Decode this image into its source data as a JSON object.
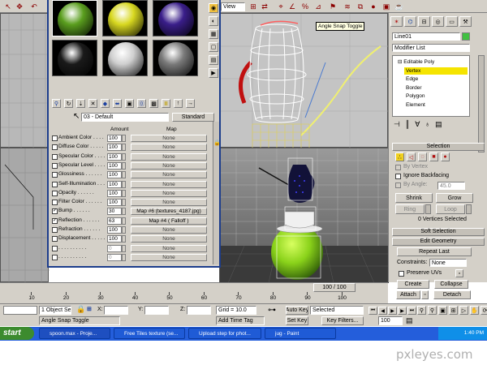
{
  "toolbar": {
    "view_label": "View",
    "snap_tooltip": "Angle Snap Toggle"
  },
  "material_editor": {
    "material_name": "03 - Default",
    "type_button": "Standard",
    "columns": {
      "amount": "Amount",
      "map": "Map"
    },
    "maps": [
      {
        "name": "Ambient Color",
        "checked": false,
        "amount": "100",
        "map": "None"
      },
      {
        "name": "Diffuse Color",
        "checked": false,
        "amount": "100",
        "map": "None"
      },
      {
        "name": "Specular Color",
        "checked": false,
        "amount": "100",
        "map": "None"
      },
      {
        "name": "Specular Level",
        "checked": false,
        "amount": "100",
        "map": "None"
      },
      {
        "name": "Glossiness",
        "checked": false,
        "amount": "100",
        "map": "None"
      },
      {
        "name": "Self-Illumination",
        "checked": false,
        "amount": "100",
        "map": "None"
      },
      {
        "name": "Opacity",
        "checked": false,
        "amount": "100",
        "map": "None"
      },
      {
        "name": "Filter Color",
        "checked": false,
        "amount": "100",
        "map": "None"
      },
      {
        "name": "Bump",
        "checked": true,
        "amount": "30",
        "map": "Map #6 (textures_4187.jpg)"
      },
      {
        "name": "Reflection",
        "checked": true,
        "amount": "63",
        "map": "Map #4  ( Falloff )"
      },
      {
        "name": "Refraction",
        "checked": false,
        "amount": "100",
        "map": "None"
      },
      {
        "name": "Displacement",
        "checked": false,
        "amount": "100",
        "map": "None"
      },
      {
        "name": "",
        "checked": false,
        "amount": "0",
        "map": "None"
      },
      {
        "name": "",
        "checked": false,
        "amount": "0",
        "map": "None"
      }
    ],
    "sample_spheres": [
      "#5a9e1e",
      "#d8d820",
      "#3a1e8a",
      "#1a1a1a",
      "#cfcfcf",
      "#7a7a7a"
    ]
  },
  "command_panel": {
    "object_name": "Line01",
    "modifier_list": "Modifier List",
    "stack": [
      {
        "label": "Editable Poly",
        "selected": false,
        "indent": false
      },
      {
        "label": "Vertex",
        "selected": true,
        "indent": true
      },
      {
        "label": "Edge",
        "selected": false,
        "indent": true
      },
      {
        "label": "Border",
        "selected": false,
        "indent": true
      },
      {
        "label": "Polygon",
        "selected": false,
        "indent": true
      },
      {
        "label": "Element",
        "selected": false,
        "indent": true
      }
    ],
    "selection": {
      "title": "Selection",
      "by_vertex": "By Vertex",
      "ignore_backfacing": "Ignore Backfacing",
      "by_angle": "By Angle:",
      "angle_value": "45.0",
      "shrink": "Shrink",
      "grow": "Grow",
      "ring": "Ring",
      "loop": "Loop",
      "status": "0 Vertices Selected"
    },
    "soft_selection": "Soft Selection",
    "edit_geometry": {
      "title": "Edit Geometry",
      "repeat_last": "Repeat Last",
      "constraints_label": "Constraints:",
      "constraints_value": "None",
      "preserve_uvs": "Preserve UVs",
      "create": "Create",
      "collapse": "Collapse",
      "attach": "Attach",
      "detach": "Detach"
    }
  },
  "timeline": {
    "frame": "100 / 100",
    "ticks": [
      "10",
      "20",
      "30",
      "40",
      "50",
      "60",
      "70",
      "80",
      "90",
      "100"
    ]
  },
  "status": {
    "selected": "1 Object Sele",
    "x_label": "X:",
    "y_label": "Y:",
    "z_label": "Z:",
    "grid": "Grid = 10.0",
    "auto_key": "Auto Key",
    "auto_key_value": "Selected",
    "set_key": "Set Key",
    "key_filters": "Key Filters...",
    "frame_value": "100",
    "prompt": "Angle Snap Toggle",
    "add_time_tag": "Add Time Tag"
  },
  "taskbar": {
    "start": "start",
    "tasks": [
      "spoon.max - Proje...",
      "Free Tiles texture (se...",
      "Upload step for phot...",
      "jug - Paint"
    ],
    "clock": "1:40 PM"
  },
  "watermark": "pxleyes.com"
}
